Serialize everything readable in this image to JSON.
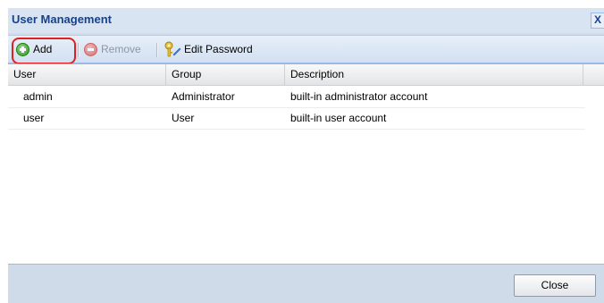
{
  "dialog": {
    "title": "User Management",
    "close_glyph": "X"
  },
  "toolbar": {
    "add_label": "Add",
    "remove_label": "Remove",
    "edit_password_label": "Edit Password"
  },
  "grid": {
    "columns": [
      "User",
      "Group",
      "Description"
    ],
    "rows": [
      {
        "user": "admin",
        "group": "Administrator",
        "description": "built-in administrator account"
      },
      {
        "user": "user",
        "group": "User",
        "description": "built-in user account"
      }
    ]
  },
  "footer": {
    "close_label": "Close"
  },
  "colors": {
    "title": "#15428b",
    "highlight": "#e02020",
    "panel": "#d2ddec"
  }
}
